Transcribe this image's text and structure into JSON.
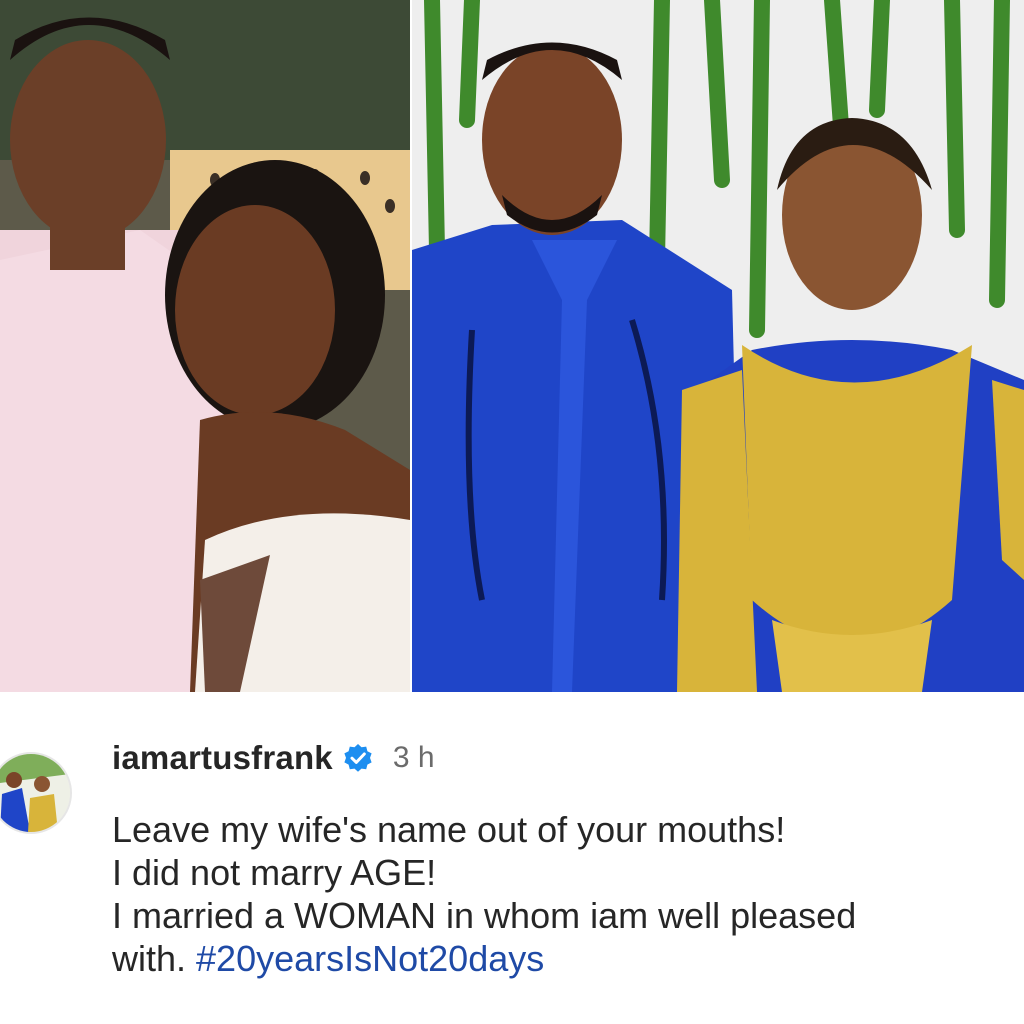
{
  "post": {
    "photo_left_alt": "Young couple photo",
    "photo_right_alt": "Couple in blue and gold attire"
  },
  "comment": {
    "username": "iamartusfrank",
    "verified_icon": "verified-badge-icon",
    "timestamp": "3 h",
    "caption_lines": [
      "Leave my wife's name out of your mouths!",
      "I did not marry AGE!",
      "I married a WOMAN in whom iam well pleased"
    ],
    "caption_last_prefix": "with. ",
    "hashtag": "#20yearsIsNot20days"
  },
  "colors": {
    "hashtag": "#1f4aa6",
    "verified": "#1d8ef0"
  }
}
